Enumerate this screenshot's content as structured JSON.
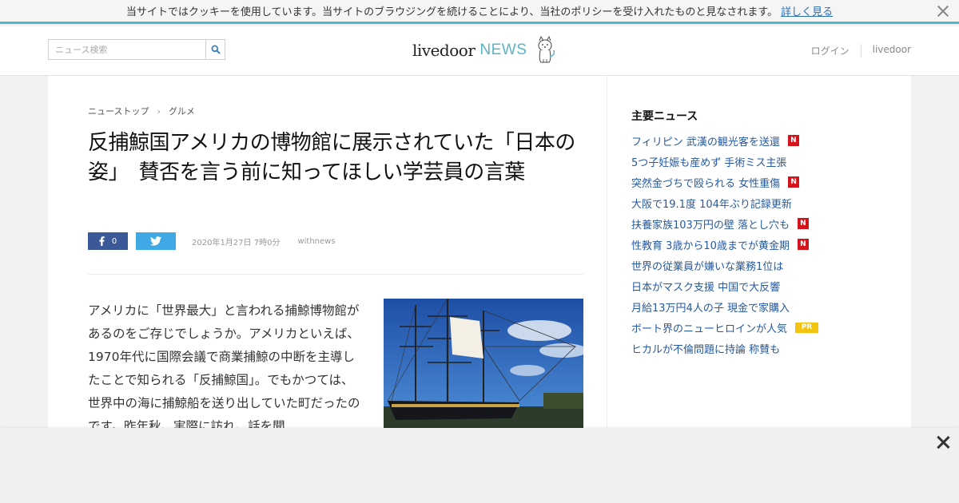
{
  "cookie_bar": {
    "message": "当サイトではクッキーを使用しています。当サイトのブラウジングを続けることにより、当社のポリシーを受け入れたものと見なされます。",
    "link_label": "詳しく見る"
  },
  "header": {
    "search": {
      "placeholder": "ニュース検索"
    },
    "logo": {
      "livedoor": "livedoor",
      "news": "NEWS"
    },
    "links": [
      "ログイン",
      "livedoor"
    ]
  },
  "breadcrumb": [
    "ニューストップ",
    "グルメ"
  ],
  "article": {
    "title": "反捕鯨国アメリカの博物館に展示されていた「日本の姿」　賛否を言う前に知ってほしい学芸員の言葉",
    "fb_count": "0",
    "date": "2020年1月27日 7時0分",
    "source": "withnews",
    "body": "アメリカに「世界最大」と言われる捕鯨博物館があるのをご存じでしょうか。アメリカといえば、1970年代に国際会議で商業捕鯨の中断を主導したことで知られる「反捕鯨国」。でもかつては、世界中の海に捕鯨船を送り出していた町だったのです。昨年秋、実際に訪れ、話を聞"
  },
  "sidebar": {
    "title": "主要ニュース",
    "items": [
      {
        "label": "フィリピン 武漢の観光客を送還",
        "badge": "N"
      },
      {
        "label": "5つ子妊娠も産めず 手術ミス主張",
        "badge": ""
      },
      {
        "label": "突然金づちで殴られる 女性重傷",
        "badge": "N"
      },
      {
        "label": "大阪で19.1度 104年ぶり記録更新",
        "badge": ""
      },
      {
        "label": "扶養家族103万円の壁 落とし穴も",
        "badge": "N"
      },
      {
        "label": "性教育 3歳から10歳までが黄金期",
        "badge": "N"
      },
      {
        "label": "世界の従業員が嫌いな業務1位は",
        "badge": ""
      },
      {
        "label": "日本がマスク支援 中国で大反響",
        "badge": ""
      },
      {
        "label": "月給13万円4人の子 現金で家購入",
        "badge": ""
      },
      {
        "label": "ボート界のニューヒロインが人気",
        "badge": "PR"
      },
      {
        "label": "ヒカルが不倫問題に持論 称賛も",
        "badge": ""
      }
    ]
  },
  "colors": {
    "accent": "#4fb8c8",
    "link": "#2659a0",
    "facebook": "#3b5998",
    "twitter": "#3fa9e6",
    "badge_new": "#d4141c",
    "badge_pr": "#f2c30f"
  }
}
